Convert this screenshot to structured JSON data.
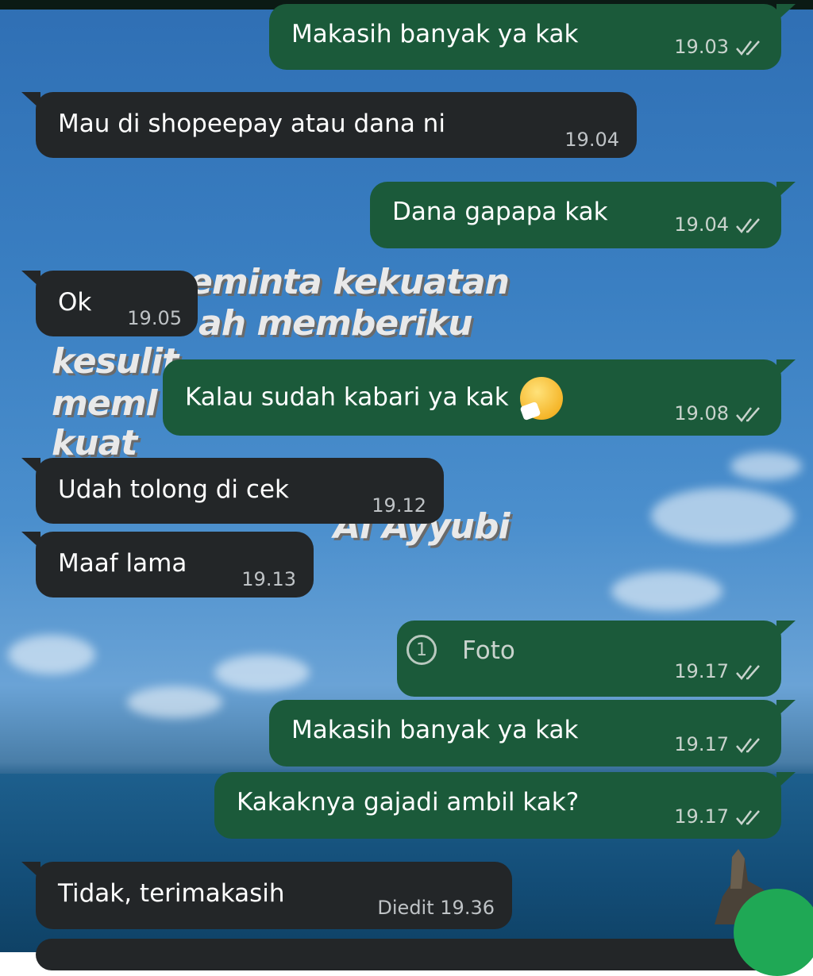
{
  "theme": {
    "incoming_bubble": "#232628",
    "outgoing_bubble": "#1b5a3a",
    "fab_color": "#1fa855"
  },
  "wallpaper_watermark": {
    "lines": [
      "eminta kekuatan",
      "ah memberiku",
      "kesulit",
      "meml",
      "kuat",
      "Al Ayyubi"
    ]
  },
  "messages": [
    {
      "direction": "out",
      "text": "Makasih banyak ya kak",
      "time": "19.03",
      "read": true
    },
    {
      "direction": "in",
      "text": "Mau di shopeepay atau dana ni",
      "time": "19.04"
    },
    {
      "direction": "out",
      "text": "Dana gapapa kak",
      "time": "19.04",
      "read": true
    },
    {
      "direction": "in",
      "text": "Ok",
      "time": "19.05"
    },
    {
      "direction": "out",
      "text": "Kalau sudah kabari ya kak",
      "emoji": "sneezing-face",
      "time": "19.08",
      "read": true
    },
    {
      "direction": "in",
      "text": "Udah tolong di cek",
      "time": "19.12"
    },
    {
      "direction": "in",
      "text": "Maaf lama",
      "time": "19.13"
    },
    {
      "direction": "out",
      "attachment": {
        "icon": "view-once-icon",
        "icon_text": "1",
        "label": "Foto"
      },
      "time": "19.17",
      "read": true
    },
    {
      "direction": "out",
      "text": "Makasih banyak ya kak",
      "time": "19.17",
      "read": true
    },
    {
      "direction": "out",
      "text": "Kakaknya gajadi ambil kak?",
      "time": "19.17",
      "read": true
    },
    {
      "direction": "in",
      "text": "Tidak, terimakasih",
      "edited_label": "Diedit",
      "time": "19.36"
    }
  ]
}
